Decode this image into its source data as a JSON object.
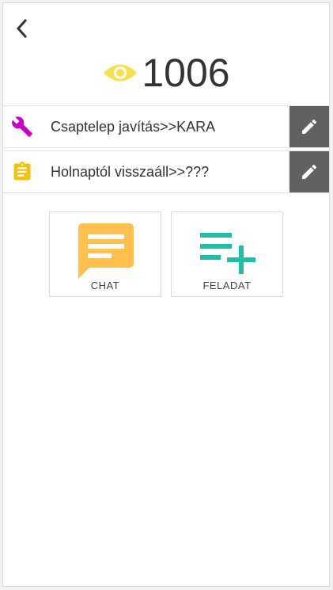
{
  "header": {
    "room_number": "1006"
  },
  "tasks": [
    {
      "icon": "wrench-icon",
      "label": "Csaptelep javítás>>KARA",
      "color": "#c800c8"
    },
    {
      "icon": "clipboard-icon",
      "label": "Holnaptól visszaáll>>???",
      "color": "#f4c20d"
    }
  ],
  "actions": {
    "chat_label": "CHAT",
    "task_label": "FELADAT"
  },
  "colors": {
    "eye": "#f4e04d",
    "chat": "#ffc04d",
    "add_task": "#1fbfa5",
    "edit_button": "#616161"
  }
}
